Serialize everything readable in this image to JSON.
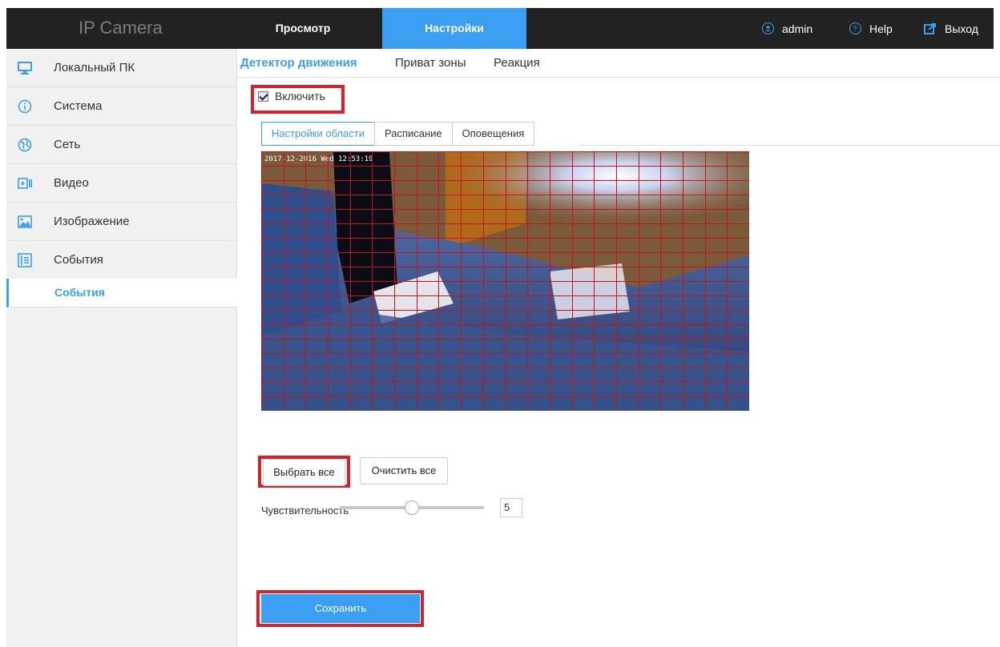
{
  "header": {
    "logo": "IP Camera",
    "tabs": [
      "Просмотр",
      "Настройки"
    ],
    "active_tab": "Настройки",
    "user": "admin",
    "help": "Help",
    "logout": "Выход",
    "accent_color": "#3a9ff2"
  },
  "sidebar": {
    "items": [
      {
        "label": "Локальный ПК",
        "icon": "monitor-icon"
      },
      {
        "label": "Система",
        "icon": "info-icon"
      },
      {
        "label": "Сеть",
        "icon": "globe-icon"
      },
      {
        "label": "Видео",
        "icon": "video-icon"
      },
      {
        "label": "Изображение",
        "icon": "image-icon"
      },
      {
        "label": "События",
        "icon": "list-icon"
      }
    ],
    "sub_item": "События"
  },
  "subtabs": [
    "Детектор движения",
    "Приват зоны",
    "Реакция"
  ],
  "enable_label": "Включить",
  "enable_checked": true,
  "crumbs": [
    "Настройки области",
    "Расписание",
    "Оповещения"
  ],
  "video": {
    "timestamp": "2017-12-2016 Wed 12:53:19"
  },
  "buttons": {
    "select_all": "Выбрать все",
    "clear_all": "Очистить все",
    "save": "Сохранить"
  },
  "sensitivity": {
    "label": "Чувствительность",
    "value": "5",
    "max": 10
  },
  "highlight_color": "#d8202a"
}
